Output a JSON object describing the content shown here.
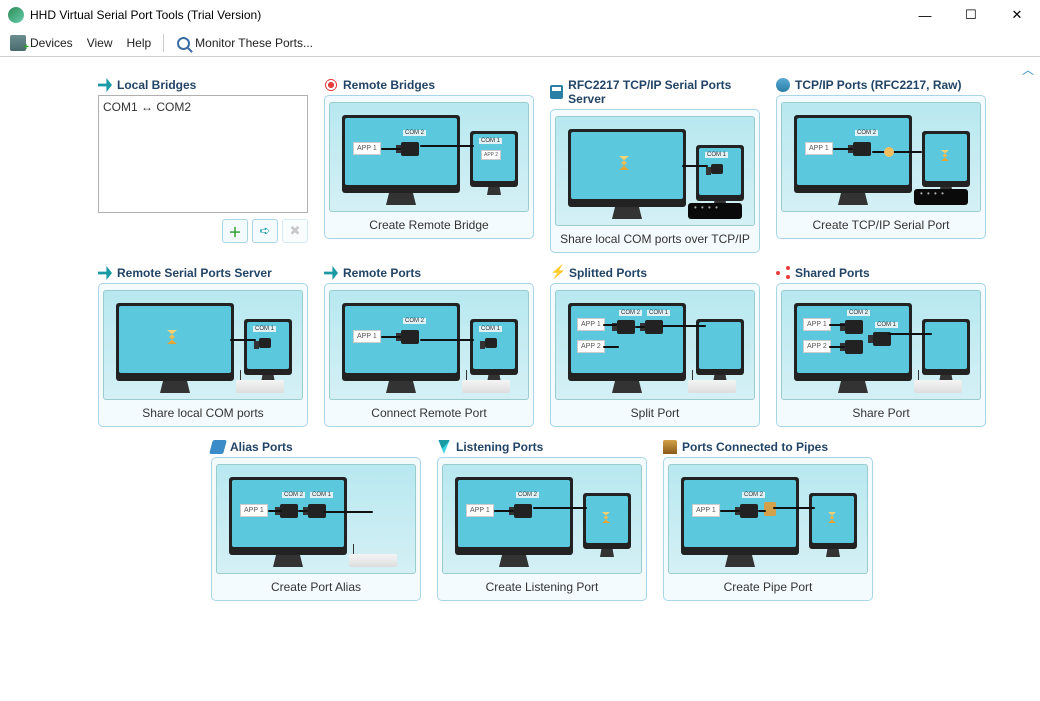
{
  "title": "HHD Virtual Serial Port Tools (Trial Version)",
  "toolbar": {
    "devices": "Devices",
    "view": "View",
    "help": "Help",
    "monitor": "Monitor These Ports..."
  },
  "local_bridges": {
    "title": "Local Bridges",
    "entry": "COM1 ↔ COM2"
  },
  "cards": {
    "remote_bridges": {
      "title": "Remote Bridges",
      "caption": "Create Remote Bridge"
    },
    "rfc_server": {
      "title": "RFC2217 TCP/IP Serial Ports Server",
      "caption": "Share local COM ports over TCP/IP"
    },
    "tcpip_ports": {
      "title": "TCP/IP Ports (RFC2217, Raw)",
      "caption": "Create TCP/IP Serial Port"
    },
    "remote_server": {
      "title": "Remote Serial Ports Server",
      "caption": "Share local COM ports"
    },
    "remote_ports": {
      "title": "Remote Ports",
      "caption": "Connect Remote Port"
    },
    "splitted": {
      "title": "Splitted Ports",
      "caption": "Split Port"
    },
    "shared": {
      "title": "Shared Ports",
      "caption": "Share Port"
    },
    "alias": {
      "title": "Alias Ports",
      "caption": "Create Port Alias"
    },
    "listening": {
      "title": "Listening Ports",
      "caption": "Create Listening Port"
    },
    "pipes": {
      "title": "Ports Connected to Pipes",
      "caption": "Create Pipe Port"
    }
  },
  "labels": {
    "app1": "APP 1",
    "app2": "APP 2",
    "com1": "COM 1",
    "com2": "COM 2"
  }
}
